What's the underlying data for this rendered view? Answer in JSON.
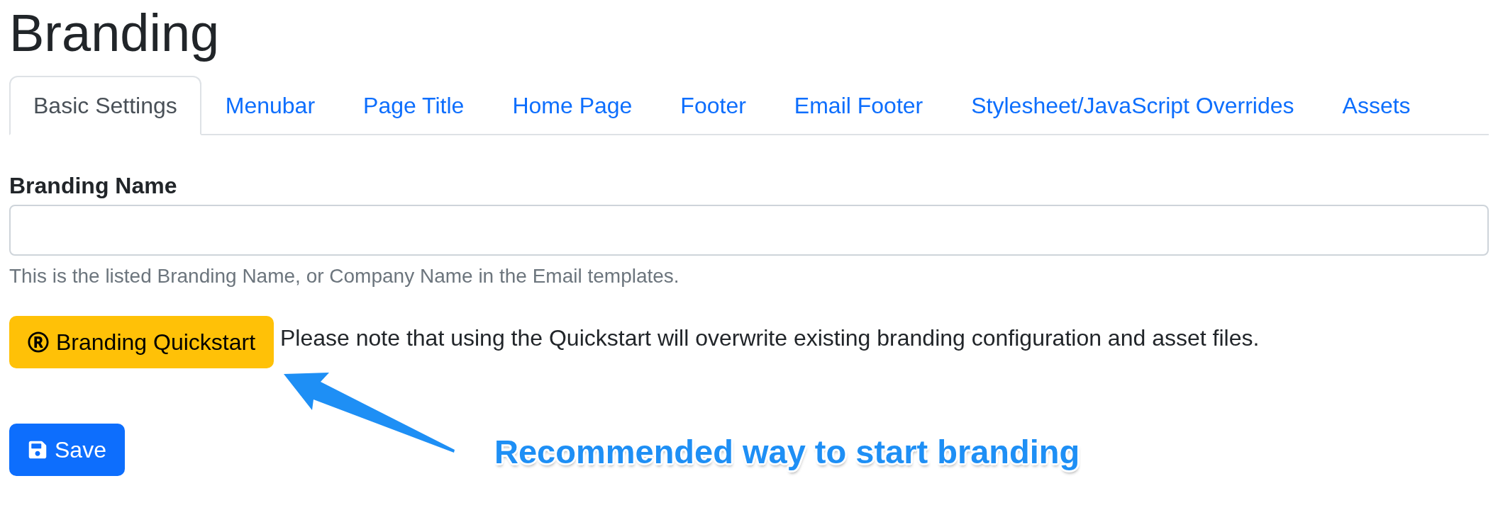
{
  "page": {
    "title": "Branding"
  },
  "tabs": [
    {
      "label": "Basic Settings",
      "selected": true
    },
    {
      "label": "Menubar",
      "selected": false
    },
    {
      "label": "Page Title",
      "selected": false
    },
    {
      "label": "Home Page",
      "selected": false
    },
    {
      "label": "Footer",
      "selected": false
    },
    {
      "label": "Email Footer",
      "selected": false
    },
    {
      "label": "Stylesheet/JavaScript Overrides",
      "selected": false
    },
    {
      "label": "Assets",
      "selected": false
    }
  ],
  "form": {
    "branding_name": {
      "label": "Branding Name",
      "help": "This is the listed Branding Name, or Company Name in the Email templates."
    }
  },
  "quickstart": {
    "button": "Branding Quickstart",
    "note": "Please note that using the Quickstart will overwrite existing branding configuration and asset files."
  },
  "save_button": "Save",
  "annotation": {
    "text": "Recommended way to start branding"
  }
}
